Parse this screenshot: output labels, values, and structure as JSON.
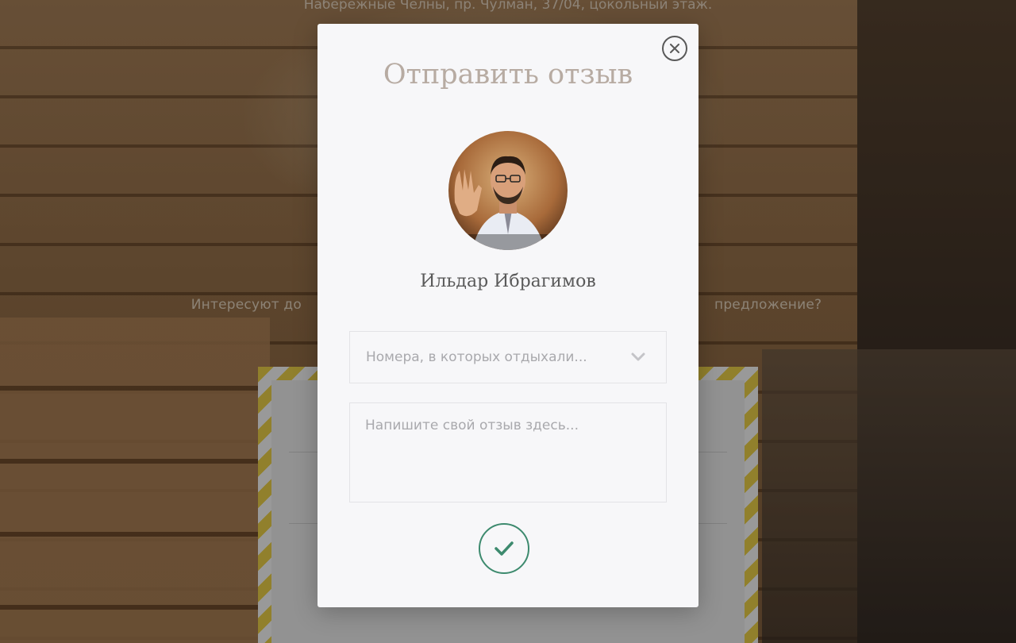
{
  "background": {
    "address": "Набережные Челны, пр. Чулман, 37/04, цокольный этаж.",
    "question_left": "Интересуют до",
    "question_right": "предложение?"
  },
  "modal": {
    "title": "Отправить отзыв",
    "user_name": "Ильдар Ибрагимов",
    "select_placeholder": "Номера, в которых отдыхали...",
    "textarea_placeholder": "Напишите свой отзыв здесь...",
    "close_icon": "close-icon",
    "submit_icon": "checkmark-icon",
    "accent_color": "#3d8a6e"
  }
}
